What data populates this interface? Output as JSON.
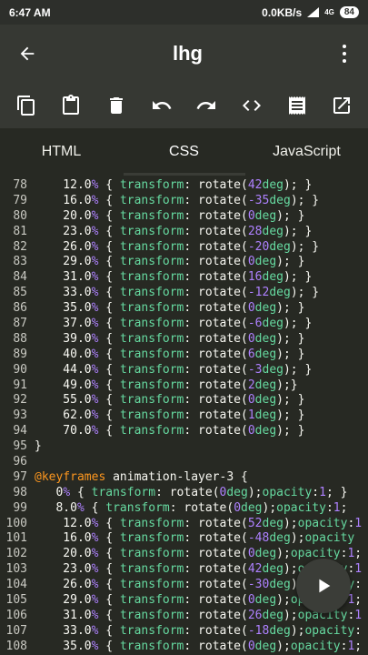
{
  "status": {
    "time": "6:47 AM",
    "speed": "0.0KB/s",
    "network": "4G",
    "battery": "84"
  },
  "appbar": {
    "title": "lhg"
  },
  "toolbar": {
    "icons": [
      "copy-icon",
      "paste-icon",
      "delete-icon",
      "undo-icon",
      "redo-icon",
      "code-icon",
      "notes-icon",
      "open-external-icon"
    ]
  },
  "tabs": [
    {
      "label": "HTML",
      "active": false
    },
    {
      "label": "CSS",
      "active": true
    },
    {
      "label": "JavaScript",
      "active": false
    }
  ],
  "editor": {
    "lines": [
      {
        "n": "78",
        "text": "    12.0% { transform: rotate(42deg); }"
      },
      {
        "n": "79",
        "text": "    16.0% { transform: rotate(-35deg); }"
      },
      {
        "n": "80",
        "text": "    20.0% { transform: rotate(0deg); }"
      },
      {
        "n": "81",
        "text": "    23.0% { transform: rotate(28deg); }"
      },
      {
        "n": "82",
        "text": "    26.0% { transform: rotate(-20deg); }"
      },
      {
        "n": "83",
        "text": "    29.0% { transform: rotate(0deg); }"
      },
      {
        "n": "84",
        "text": "    31.0% { transform: rotate(16deg); }"
      },
      {
        "n": "85",
        "text": "    33.0% { transform: rotate(-12deg); }"
      },
      {
        "n": "86",
        "text": "    35.0% { transform: rotate(0deg); }"
      },
      {
        "n": "87",
        "text": "    37.0% { transform: rotate(-6deg); }"
      },
      {
        "n": "88",
        "text": "    39.0% { transform: rotate(0deg); }"
      },
      {
        "n": "89",
        "text": "    40.0% { transform: rotate(6deg); }"
      },
      {
        "n": "90",
        "text": "    44.0% { transform: rotate(-3deg); }"
      },
      {
        "n": "91",
        "text": "    49.0% { transform: rotate(2deg);}"
      },
      {
        "n": "92",
        "text": "    55.0% { transform: rotate(0deg); }"
      },
      {
        "n": "93",
        "text": "    62.0% { transform: rotate(1deg); }"
      },
      {
        "n": "94",
        "text": "    70.0% { transform: rotate(0deg); }"
      },
      {
        "n": "95",
        "text": "}"
      },
      {
        "n": "96",
        "text": ""
      },
      {
        "n": "97",
        "text": "@keyframes animation-layer-3 {"
      },
      {
        "n": "98",
        "text": "   0% { transform: rotate(0deg);opacity:1; }"
      },
      {
        "n": "99",
        "text": "   8.0% { transform: rotate(0deg);opacity:1;"
      },
      {
        "n": "100",
        "text": "    12.0% { transform: rotate(52deg);opacity:1"
      },
      {
        "n": "101",
        "text": "    16.0% { transform: rotate(-48deg);opacity"
      },
      {
        "n": "102",
        "text": "    20.0% { transform: rotate(0deg);opacity:1;"
      },
      {
        "n": "103",
        "text": "    23.0% { transform: rotate(42deg);opacity:1"
      },
      {
        "n": "104",
        "text": "    26.0% { transform: rotate(-30deg);opacity:"
      },
      {
        "n": "105",
        "text": "    29.0% { transform: rotate(0deg);opacity:1;"
      },
      {
        "n": "106",
        "text": "    31.0% { transform: rotate(26deg);opacity:1"
      },
      {
        "n": "107",
        "text": "    33.0% { transform: rotate(-18deg);opacity:"
      },
      {
        "n": "108",
        "text": "    35.0% { transform: rotate(0deg);opacity:1;"
      }
    ]
  },
  "fab": {
    "icon": "play-icon"
  },
  "colors": {
    "background": "#272923",
    "appbar": "#363833",
    "property": "#66d9a0",
    "number": "#ae81ff",
    "keyword": "#fd971f"
  }
}
